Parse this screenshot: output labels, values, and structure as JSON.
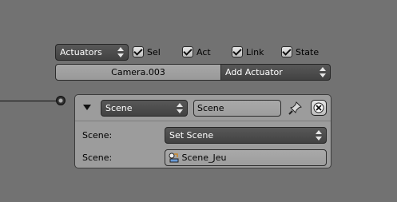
{
  "top_bar": {
    "type_select": "Actuators",
    "checks": [
      {
        "label": "Sel",
        "checked": true
      },
      {
        "label": "Act",
        "checked": true
      },
      {
        "label": "Link",
        "checked": true
      },
      {
        "label": "State",
        "checked": true
      }
    ]
  },
  "header_row": {
    "object_name": "Camera.003",
    "add_menu": "Add Actuator"
  },
  "actuator": {
    "type": "Scene",
    "name": "Scene",
    "rows": [
      {
        "label": "Scene:",
        "value": "Set Scene"
      },
      {
        "label": "Scene:",
        "value": "Scene_Jeu"
      }
    ]
  },
  "icons": [
    "collapse-triangle-icon",
    "pin-icon",
    "close-icon",
    "scene-icon",
    "link-socket-icon"
  ]
}
